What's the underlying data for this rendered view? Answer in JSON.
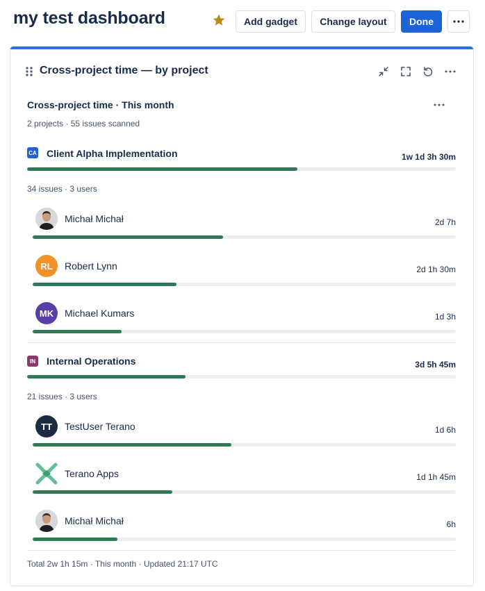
{
  "header": {
    "title": "my test dashboard",
    "add_gadget": "Add gadget",
    "change_layout": "Change layout",
    "done": "Done",
    "more": "···"
  },
  "colors": {
    "accent": "#1d62d6",
    "star": "#b9891b",
    "bar": "#2f7a55",
    "track": "#ecedf0"
  },
  "gadget": {
    "title": "Cross-project time — by project",
    "subtitle": "Cross-project time · This month",
    "summary": "2 projects · 55 issues scanned",
    "more": "···",
    "footer": "Total 2w 1h 15m · This month · Updated 21:17 UTC",
    "icons": [
      "minimize-icon",
      "fullscreen-icon",
      "refresh-icon",
      "more-icon"
    ]
  },
  "projects": [
    {
      "key": "CA",
      "name": "Client Alpha Implementation",
      "total": "1w 1d 3h 30m",
      "fraction": 0.63,
      "badge_color": "#1d62d6",
      "meta": "34 issues · 3 users",
      "users": [
        {
          "name": "Michał Michał",
          "time": "2d 7h",
          "fraction": 0.45,
          "avatar": "photo",
          "initials": ""
        },
        {
          "name": "Robert Lynn",
          "time": "2d 1h 30m",
          "fraction": 0.34,
          "avatar": "initials",
          "initials": "RL",
          "color": "#f0922b"
        },
        {
          "name": "Michael Kumars",
          "time": "1d 3h",
          "fraction": 0.21,
          "avatar": "initials",
          "initials": "MK",
          "color": "#5a3ea8"
        }
      ]
    },
    {
      "key": "IN",
      "name": "Internal Operations",
      "total": "3d 5h 45m",
      "fraction": 0.37,
      "badge_color": "#8c3a6e",
      "meta": "21 issues · 3 users",
      "users": [
        {
          "name": "TestUser Terano",
          "time": "1d 6h",
          "fraction": 0.47,
          "avatar": "initials",
          "initials": "TT",
          "color": "#1c2b42"
        },
        {
          "name": "Terano Apps",
          "time": "1d 1h 45m",
          "fraction": 0.33,
          "avatar": "logo",
          "initials": ""
        },
        {
          "name": "Michał Michał",
          "time": "6h",
          "fraction": 0.2,
          "avatar": "photo",
          "initials": ""
        }
      ]
    }
  ]
}
